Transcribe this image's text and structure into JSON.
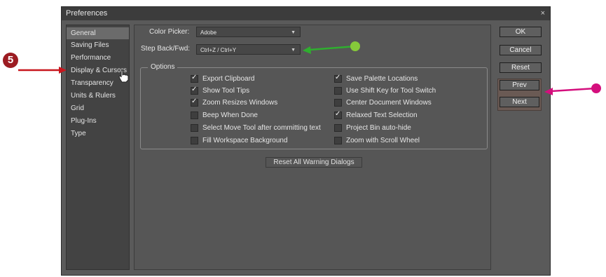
{
  "window": {
    "title": "Preferences",
    "close_glyph": "×"
  },
  "sidebar": {
    "items": [
      {
        "label": "General"
      },
      {
        "label": "Saving Files"
      },
      {
        "label": "Performance"
      },
      {
        "label": "Display & Cursors"
      },
      {
        "label": "Transparency"
      },
      {
        "label": "Units & Rulers"
      },
      {
        "label": "Grid"
      },
      {
        "label": "Plug-Ins"
      },
      {
        "label": "Type"
      }
    ]
  },
  "fields": {
    "color_picker": {
      "label": "Color Picker:",
      "value": "Adobe"
    },
    "step_back": {
      "label": "Step Back/Fwd:",
      "value": "Ctrl+Z / Ctrl+Y"
    }
  },
  "options": {
    "title": "Options",
    "left": [
      {
        "label": "Export Clipboard",
        "checked": true
      },
      {
        "label": "Show Tool Tips",
        "checked": true
      },
      {
        "label": "Zoom Resizes Windows",
        "checked": true
      },
      {
        "label": "Beep When Done",
        "checked": false
      },
      {
        "label": "Select Move Tool after committing text",
        "checked": false
      },
      {
        "label": "Fill Workspace Background",
        "checked": false
      }
    ],
    "right": [
      {
        "label": "Save Palette Locations",
        "checked": true
      },
      {
        "label": "Use Shift Key for Tool Switch",
        "checked": false
      },
      {
        "label": "Center Document Windows",
        "checked": false
      },
      {
        "label": "Relaxed Text Selection",
        "checked": true
      },
      {
        "label": "Project Bin auto-hide",
        "checked": false
      },
      {
        "label": "Zoom with Scroll Wheel",
        "checked": false
      }
    ]
  },
  "buttons": {
    "reset_warnings": "Reset All Warning Dialogs",
    "ok": "OK",
    "cancel": "Cancel",
    "reset": "Reset",
    "prev": "Prev",
    "next": "Next"
  },
  "annotations": {
    "step_badge": "5",
    "red_arrow_color": "#c8161d",
    "green_arrow_color": "#2fae2f",
    "green_dot_color": "#86c93a",
    "magenta_arrow_color": "#d40f7d"
  },
  "icons": {
    "cursor": "hand-pointer-icon",
    "dropdown": "chevron-down-icon"
  }
}
